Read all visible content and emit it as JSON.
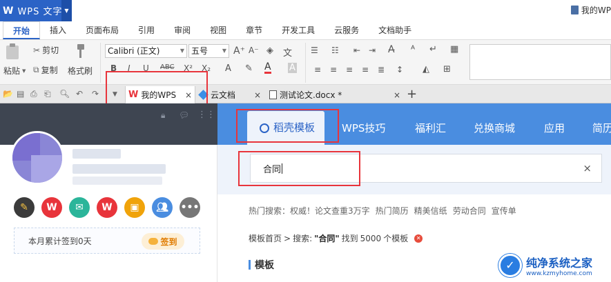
{
  "titlebar": {
    "app_logo": "W",
    "app_name": "WPS 文字",
    "dropdown": "▼",
    "doc_name": "我的WP"
  },
  "ribbon_tabs": [
    "开始",
    "插入",
    "页面布局",
    "引用",
    "审阅",
    "视图",
    "章节",
    "开发工具",
    "云服务",
    "文档助手"
  ],
  "ribbon": {
    "paste": "粘贴",
    "cut": "剪切",
    "copy": "复制",
    "format_painter": "格式刷",
    "font": "Calibri (正文)",
    "font_size": "五号"
  },
  "doc_tabs": [
    {
      "label": "我的WPS",
      "close": "×"
    },
    {
      "label": "云文档",
      "close": "×"
    },
    {
      "label": "测试论文.docx *",
      "close": "×"
    }
  ],
  "doc_tabs_add": "+",
  "sidebar": {
    "sign_text": "本月累计签到0天",
    "sign_button": "签到",
    "app_icons": [
      {
        "icon": "dao-ke-icon",
        "color": "#3b3b3b"
      },
      {
        "icon": "wps-icon",
        "color": "#e8343b"
      },
      {
        "icon": "mail-icon",
        "color": "#2bb59a"
      },
      {
        "icon": "wps-plus-icon",
        "color": "#e8343b"
      },
      {
        "icon": "calendar-icon",
        "color": "#f0a30a"
      },
      {
        "icon": "contacts-icon",
        "color": "#4a8de0"
      },
      {
        "icon": "more-icon",
        "color": "#777777"
      }
    ]
  },
  "nav": {
    "items": [
      "稻壳模板",
      "WPS技巧",
      "福利汇",
      "兑换商城",
      "应用",
      "简历"
    ]
  },
  "search": {
    "value": "合同",
    "clear": "×"
  },
  "hot_search": {
    "label": "热门搜索：",
    "items": [
      "权威！论文查重3万字",
      "热门简历",
      "精美信纸",
      "劳动合同",
      "宣传单"
    ]
  },
  "breadcrumb": {
    "home": "模板首页",
    "sep": ">",
    "search_label": "搜索:",
    "query": "\"合同\"",
    "found_prefix": "找到",
    "count": "5000",
    "found_suffix": "个模板"
  },
  "section_title": "模板",
  "watermark": {
    "title": "纯净系统之家",
    "url": "www.kzmyhome.com"
  },
  "colors": {
    "brand_blue": "#2b63c6",
    "nav_blue": "#4a8de0",
    "highlight_red": "#e8343b"
  }
}
